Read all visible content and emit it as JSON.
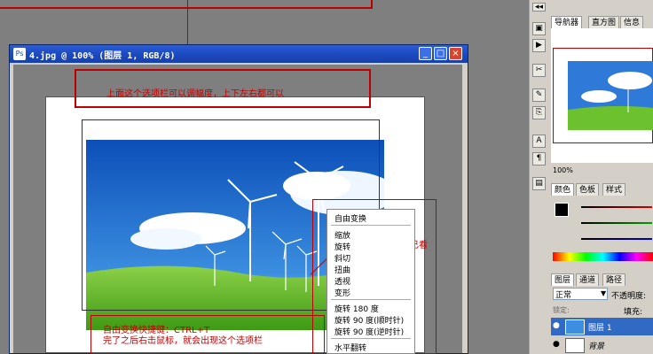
{
  "document": {
    "title": "4.jpg @ 100% (图层 1, RGB/8)",
    "min": "_",
    "max": "□",
    "close": "×"
  },
  "annotations": {
    "top_box": "上面这个选项栏可以调幅度，上下左右都可以",
    "right_note": "这里可选择自己看",
    "bottom_note_1": "自由变换快捷键：CTRL+T",
    "bottom_note_2": "完了之后右击鼠标，就会出现这个选项栏"
  },
  "context_menu": {
    "items": [
      "自由变换",
      "缩放",
      "旋转",
      "斜切",
      "扭曲",
      "透视",
      "变形",
      "旋转 180 度",
      "旋转 90 度(顺时针)",
      "旋转 90 度(逆时针)",
      "水平翻转"
    ]
  },
  "navigator": {
    "tabs": [
      "导航器",
      "直方图",
      "信息"
    ],
    "zoom": "100%"
  },
  "color_panel": {
    "tabs": [
      "颜色",
      "色板",
      "样式"
    ]
  },
  "layers_panel": {
    "tabs": [
      "图层",
      "通道",
      "路径"
    ],
    "blend_mode": "正常",
    "opacity_label": "不透明度:",
    "lock_label": "锁定:",
    "fill_label": "填充:",
    "layers": [
      "图层 1",
      "背景"
    ]
  },
  "colors": {
    "annotation_red": "#c00000",
    "title_blue": "#2a5dd8",
    "selected_layer": "#316ac5"
  }
}
